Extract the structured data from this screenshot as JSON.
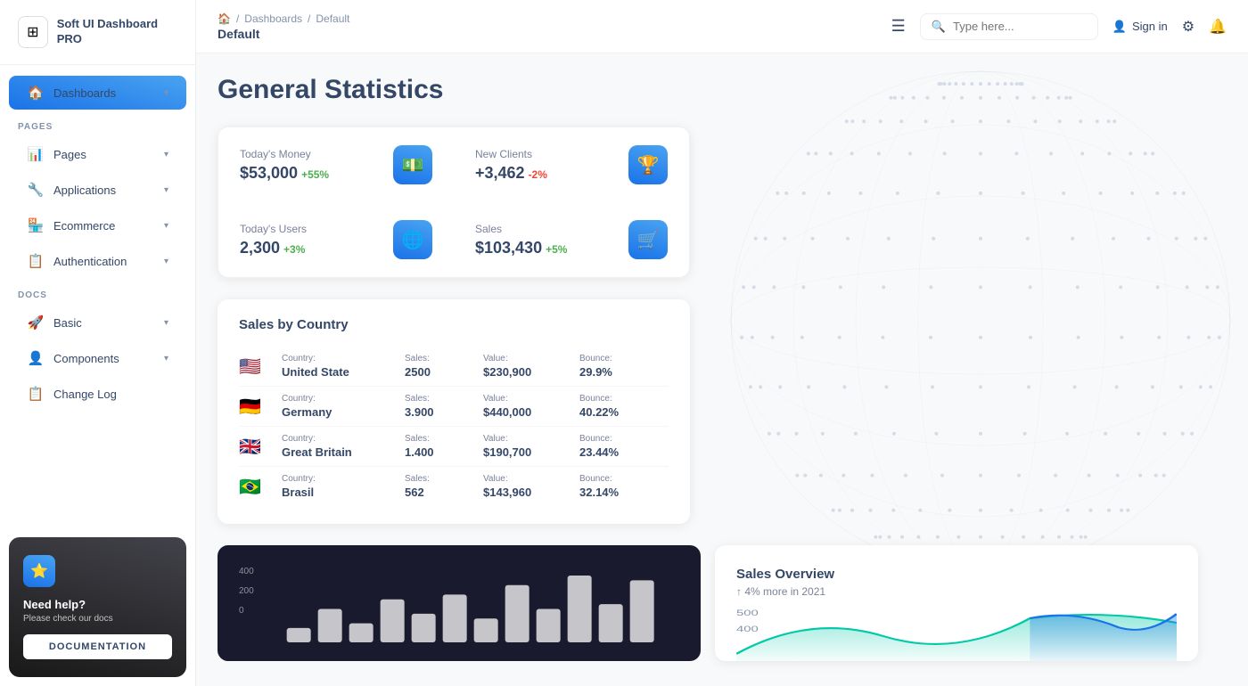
{
  "app": {
    "name": "Soft UI Dashboard PRO"
  },
  "sidebar": {
    "logo_icon": "⊞",
    "sections": [
      {
        "label": "",
        "items": [
          {
            "id": "dashboards",
            "label": "Dashboards",
            "icon": "🏠",
            "active": true,
            "chevron": "▾"
          }
        ]
      },
      {
        "label": "PAGES",
        "items": [
          {
            "id": "pages",
            "label": "Pages",
            "icon": "📊",
            "active": false,
            "chevron": "▾"
          },
          {
            "id": "applications",
            "label": "Applications",
            "icon": "🔧",
            "active": false,
            "chevron": "▾"
          },
          {
            "id": "ecommerce",
            "label": "Ecommerce",
            "icon": "🏪",
            "active": false,
            "chevron": "▾"
          },
          {
            "id": "authentication",
            "label": "Authentication",
            "icon": "📋",
            "active": false,
            "chevron": "▾"
          }
        ]
      },
      {
        "label": "DOCS",
        "items": [
          {
            "id": "basic",
            "label": "Basic",
            "icon": "🚀",
            "active": false,
            "chevron": "▾"
          },
          {
            "id": "components",
            "label": "Components",
            "icon": "👤",
            "active": false,
            "chevron": "▾"
          },
          {
            "id": "changelog",
            "label": "Change Log",
            "icon": "📋",
            "active": false,
            "chevron": ""
          }
        ]
      }
    ],
    "help": {
      "star": "⭐",
      "title": "Need help?",
      "subtitle": "Please check our docs",
      "button_label": "DOCUMENTATION"
    }
  },
  "topnav": {
    "breadcrumb": {
      "home_icon": "🏠",
      "separator": "/",
      "parent": "Dashboards",
      "current": "Default",
      "title": "Default"
    },
    "hamburger": "☰",
    "search": {
      "placeholder": "Type here..."
    },
    "signin": "Sign in",
    "gear_icon": "⚙",
    "bell_icon": "🔔"
  },
  "main": {
    "title": "General Statistics",
    "stats": [
      {
        "label": "Today's Money",
        "value": "$53,000",
        "change": "+55%",
        "change_type": "positive",
        "icon": "$"
      },
      {
        "label": "New Clients",
        "value": "+3,462",
        "change": "-2%",
        "change_type": "negative",
        "icon": "🏆"
      },
      {
        "label": "Today's Users",
        "value": "2,300",
        "change": "+3%",
        "change_type": "positive",
        "icon": "🌐"
      },
      {
        "label": "Sales",
        "value": "$103,430",
        "change": "+5%",
        "change_type": "positive",
        "icon": "🛒"
      }
    ],
    "sales_by_country": {
      "title": "Sales by Country",
      "columns": {
        "country": "Country:",
        "sales": "Sales:",
        "value": "Value:",
        "bounce": "Bounce:"
      },
      "rows": [
        {
          "flag": "🇺🇸",
          "country": "United State",
          "sales": "2500",
          "value": "$230,900",
          "bounce": "29.9%"
        },
        {
          "flag": "🇩🇪",
          "country": "Germany",
          "sales": "3.900",
          "value": "$440,000",
          "bounce": "40.22%"
        },
        {
          "flag": "🇬🇧",
          "country": "Great Britain",
          "sales": "1.400",
          "value": "$190,700",
          "bounce": "23.44%"
        },
        {
          "flag": "🇧🇷",
          "country": "Brasil",
          "sales": "562",
          "value": "$143,960",
          "bounce": "32.14%"
        }
      ]
    },
    "bar_chart": {
      "y_labels": [
        "400",
        "200",
        "0"
      ],
      "bars": [
        15,
        35,
        20,
        45,
        30,
        50,
        25,
        60,
        35,
        70,
        40,
        65
      ],
      "x_labels": []
    },
    "sales_overview": {
      "title": "Sales Overview",
      "change_icon": "↑",
      "change": "4% more in 2021",
      "y_labels": [
        "500",
        "400"
      ],
      "line_data": [
        30,
        60,
        40,
        80,
        50,
        90,
        60
      ]
    }
  }
}
